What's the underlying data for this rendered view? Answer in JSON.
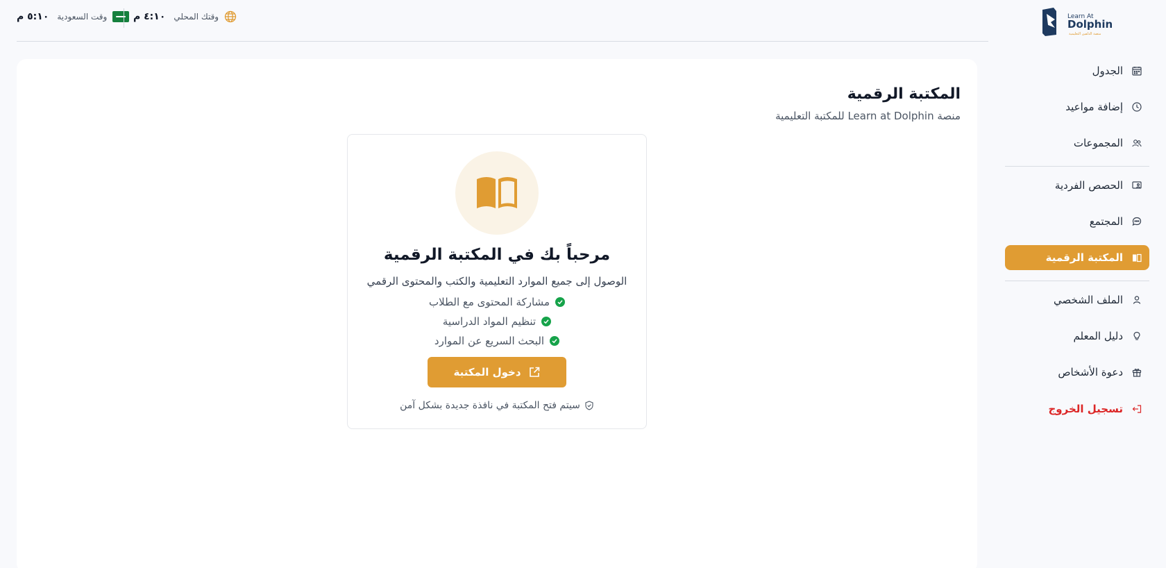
{
  "brand": {
    "logo_line1": "Learn At",
    "logo_line2": "Dolphin",
    "logo_tagline": "منصة الدلفين التعليمية",
    "accent_color": "#e09c33"
  },
  "topbar": {
    "saudi_time": "٥:١٠ م",
    "saudi_label": "وقت السعودية",
    "local_time": "٤:١٠ م",
    "local_label": "وقتك المحلي",
    "globe_icon": "globe-icon",
    "flag_icon": "saudi-flag-icon"
  },
  "sidebar": {
    "items": [
      {
        "label": "الجدول",
        "icon": "calendar-icon"
      },
      {
        "label": "إضافة مواعيد",
        "icon": "clock-icon"
      },
      {
        "label": "المجموعات",
        "icon": "users-icon"
      },
      {
        "label": "الحصص الفردية",
        "icon": "screen-user-icon"
      },
      {
        "label": "المجتمع",
        "icon": "chat-icon"
      },
      {
        "label": "المكتبة الرقمية",
        "icon": "book-icon",
        "active": true
      },
      {
        "label": "الملف الشخصي",
        "icon": "user-icon"
      },
      {
        "label": "دليل المعلم",
        "icon": "lightbulb-icon"
      },
      {
        "label": "دعوة الأشخاص",
        "icon": "gift-icon"
      },
      {
        "label": "تسجيل الخروج",
        "icon": "logout-icon",
        "danger": true
      }
    ]
  },
  "main": {
    "title": "المكتبة الرقمية",
    "subtitle": "منصة Learn at Dolphin للمكتبة التعليمية",
    "card": {
      "title": "مرحباً بك في المكتبة الرقمية",
      "description": "الوصول إلى جميع الموارد التعليمية والكتب والمحتوى الرقمي",
      "features": [
        "مشاركة المحتوى مع الطلاب",
        "تنظيم المواد الدراسية",
        "البحث السريع عن الموارد"
      ],
      "button_label": "دخول المكتبة",
      "secure_note": "سيتم فتح المكتبة في نافذة جديدة بشكل آمن"
    }
  }
}
